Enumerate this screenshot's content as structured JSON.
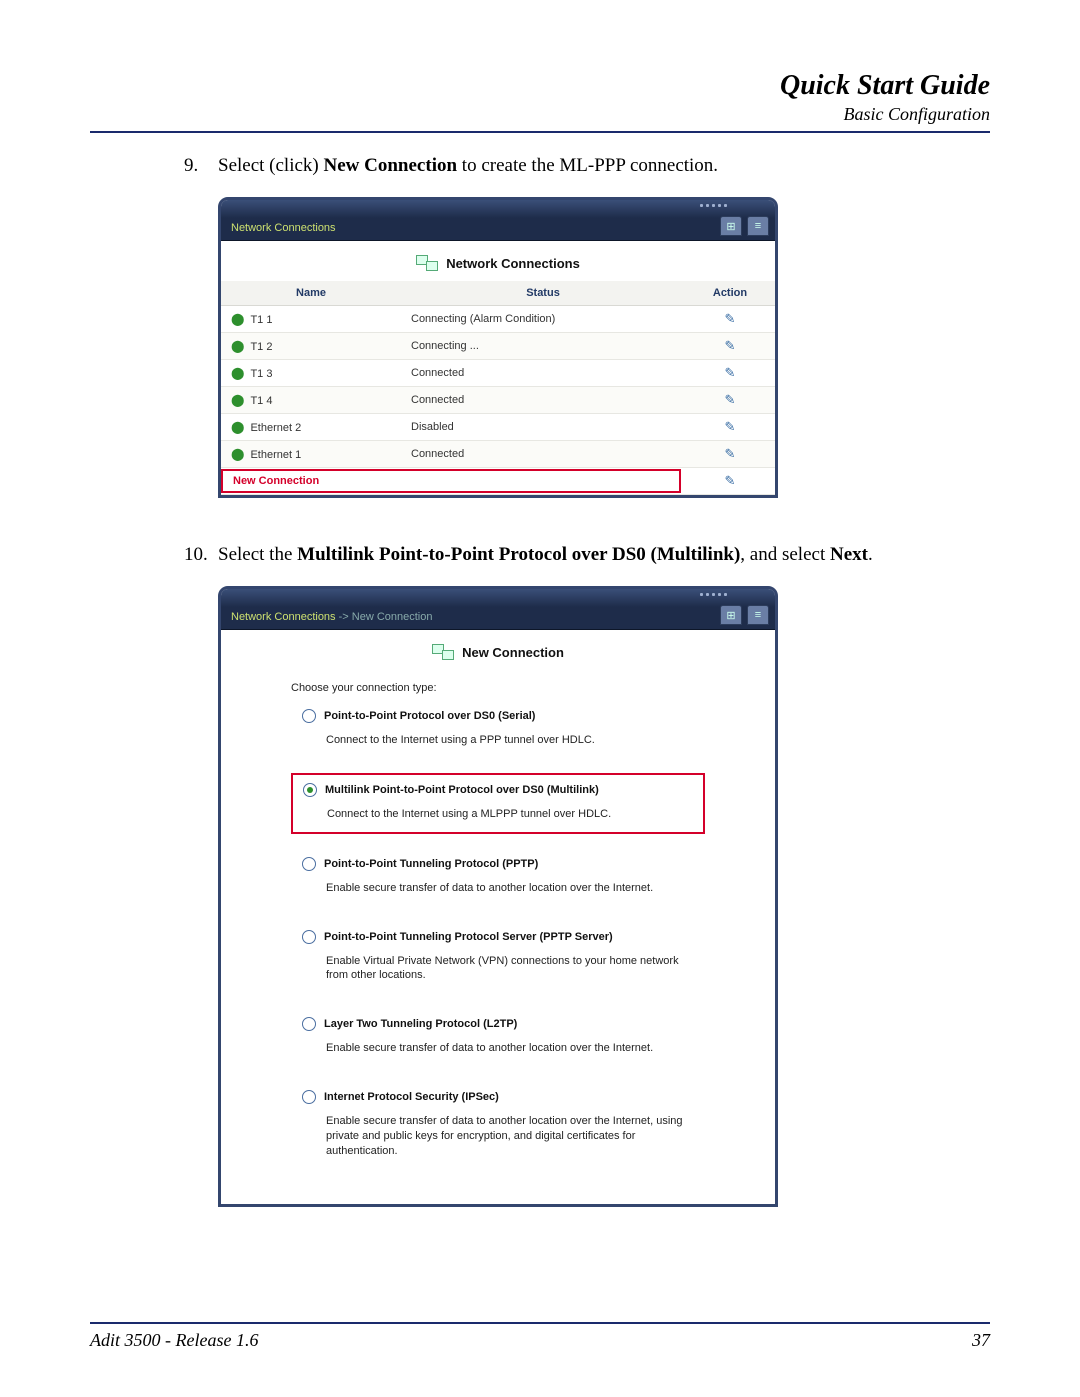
{
  "header": {
    "title": "Quick Start Guide",
    "subtitle": "Basic Configuration"
  },
  "footer": {
    "product": "Adit 3500  - Release 1.6",
    "page": "37"
  },
  "step9": {
    "num": "9.",
    "pre": "Select (click) ",
    "bold": "New Connection",
    "post": " to create the ML-PPP connection."
  },
  "step10": {
    "num": "10.",
    "pre": "Select the ",
    "bold": "Multilink Point-to-Point Protocol over DS0 (Multilink)",
    "mid": ", and select ",
    "bold2": "Next",
    "post": "."
  },
  "shot1": {
    "breadcrumb": "Network Connections",
    "title": "Network Connections",
    "cols": {
      "name": "Name",
      "status": "Status",
      "action": "Action"
    },
    "rows": [
      {
        "name": "T1 1",
        "status": "Connecting (Alarm Condition)",
        "status_class": ""
      },
      {
        "name": "T1 2",
        "status": "Connecting ...",
        "status_class": ""
      },
      {
        "name": "T1 3",
        "status": "Connected",
        "status_class": "status-ok"
      },
      {
        "name": "T1 4",
        "status": "Connected",
        "status_class": "status-ok"
      },
      {
        "name": "Ethernet 2",
        "status": "Disabled",
        "status_class": "status-dis"
      },
      {
        "name": "Ethernet 1",
        "status": "Connected",
        "status_class": "status-ok"
      }
    ],
    "new_connection": "New Connection"
  },
  "shot2": {
    "breadcrumb_a": "Network Connections",
    "breadcrumb_sep": " -> ",
    "breadcrumb_b": "New Connection",
    "title": "New Connection",
    "choose": "Choose your connection type:",
    "options": [
      {
        "title": "Point-to-Point Protocol over DS0 (Serial)",
        "desc": "Connect to the Internet using a PPP tunnel over HDLC.",
        "selected": false
      },
      {
        "title": "Multilink Point-to-Point Protocol over DS0 (Multilink)",
        "desc": "Connect to the Internet using a MLPPP tunnel over HDLC.",
        "selected": true
      },
      {
        "title": "Point-to-Point Tunneling Protocol (PPTP)",
        "desc": "Enable secure transfer of data to another location over the Internet.",
        "selected": false
      },
      {
        "title": "Point-to-Point Tunneling Protocol Server (PPTP Server)",
        "desc": "Enable Virtual Private Network (VPN) connections to your home network from other locations.",
        "selected": false
      },
      {
        "title": "Layer Two Tunneling Protocol (L2TP)",
        "desc": "Enable secure transfer of data to another location over the Internet.",
        "selected": false
      },
      {
        "title": "Internet Protocol Security (IPSec)",
        "desc": "Enable secure transfer of data to another location over the Internet, using private and public keys for encryption, and digital certificates for authentication.",
        "selected": false
      }
    ]
  }
}
